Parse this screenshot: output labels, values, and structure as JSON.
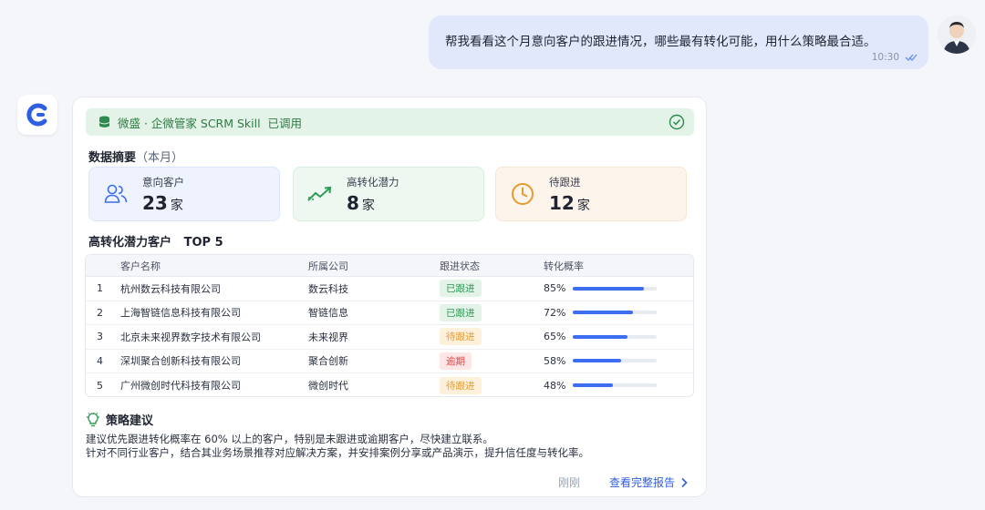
{
  "user_message": {
    "text": "帮我看看这个月意向客户的跟进情况，哪些最有转化可能，用什么策略最合适。",
    "time": "10:30",
    "read_status_icon": "double-check-icon"
  },
  "assistant": {
    "avatar_icon": "brand-c-logo-icon",
    "skill_banner": {
      "text": "微盛 · 企微管家 SCRM Skill  已调用",
      "icon": "database-icon",
      "status_icon": "check-circle-icon"
    },
    "summary": {
      "title": "数据摘要",
      "period": "（本月）",
      "stats": [
        {
          "label": "意向客户",
          "value": "23",
          "unit": "家",
          "icon": "users-icon",
          "bg": "#eef3fd",
          "border": "#dbe5fb",
          "color": "#3d6df0"
        },
        {
          "label": "高转化潜力",
          "value": "8",
          "unit": "家",
          "icon": "trend-up-icon",
          "bg": "#eef8f1",
          "border": "#d6eedd",
          "color": "#2e9a55"
        },
        {
          "label": "待跟进",
          "value": "12",
          "unit": "家",
          "icon": "clock-icon",
          "bg": "#fdf5ec",
          "border": "#f7e6d2",
          "color": "#e69a2e"
        }
      ]
    },
    "top_section": {
      "title": "高转化潜力客户",
      "subtitle": "TOP 5"
    },
    "table": {
      "headers": [
        "客户名称",
        "所属公司",
        "跟进状态",
        "转化概率"
      ],
      "rows": [
        {
          "rank": "1",
          "name": "杭州数云科技有限公司",
          "company": "数云科技",
          "status": "已跟进",
          "status_bg": "#e3f3e8",
          "status_color": "#2e9a55",
          "rate": "85%",
          "rate_value": 0.85
        },
        {
          "rank": "2",
          "name": "上海智链信息科技有限公司",
          "company": "智链信息",
          "status": "已跟进",
          "status_bg": "#e3f3e8",
          "status_color": "#2e9a55",
          "rate": "72%",
          "rate_value": 0.72
        },
        {
          "rank": "3",
          "name": "北京未来视界数字技术有限公司",
          "company": "未来视界",
          "status": "待跟进",
          "status_bg": "#fdf1dc",
          "status_color": "#e69a2e",
          "rate": "65%",
          "rate_value": 0.65
        },
        {
          "rank": "4",
          "name": "深圳聚合创新科技有限公司",
          "company": "聚合创新",
          "status": "逾期",
          "status_bg": "#fde6e6",
          "status_color": "#e04848",
          "rate": "58%",
          "rate_value": 0.58
        },
        {
          "rank": "5",
          "name": "广州微创时代科技有限公司",
          "company": "微创时代",
          "status": "待跟进",
          "status_bg": "#fdf1dc",
          "status_color": "#e69a2e",
          "rate": "48%",
          "rate_value": 0.48
        }
      ]
    },
    "strategy": {
      "title": "策略建议",
      "icon": "lightbulb-icon",
      "lines": [
        "建议优先跟进转化概率在 60% 以上的客户，特别是未跟进或逾期客户，尽快建立联系。",
        "针对不同行业客户，结合其业务场景推荐对应解决方案，并安排案例分享或产品演示，提升信任度与转化率。"
      ]
    },
    "footer": {
      "time": "刚刚",
      "link_label": "查看完整报告"
    }
  }
}
